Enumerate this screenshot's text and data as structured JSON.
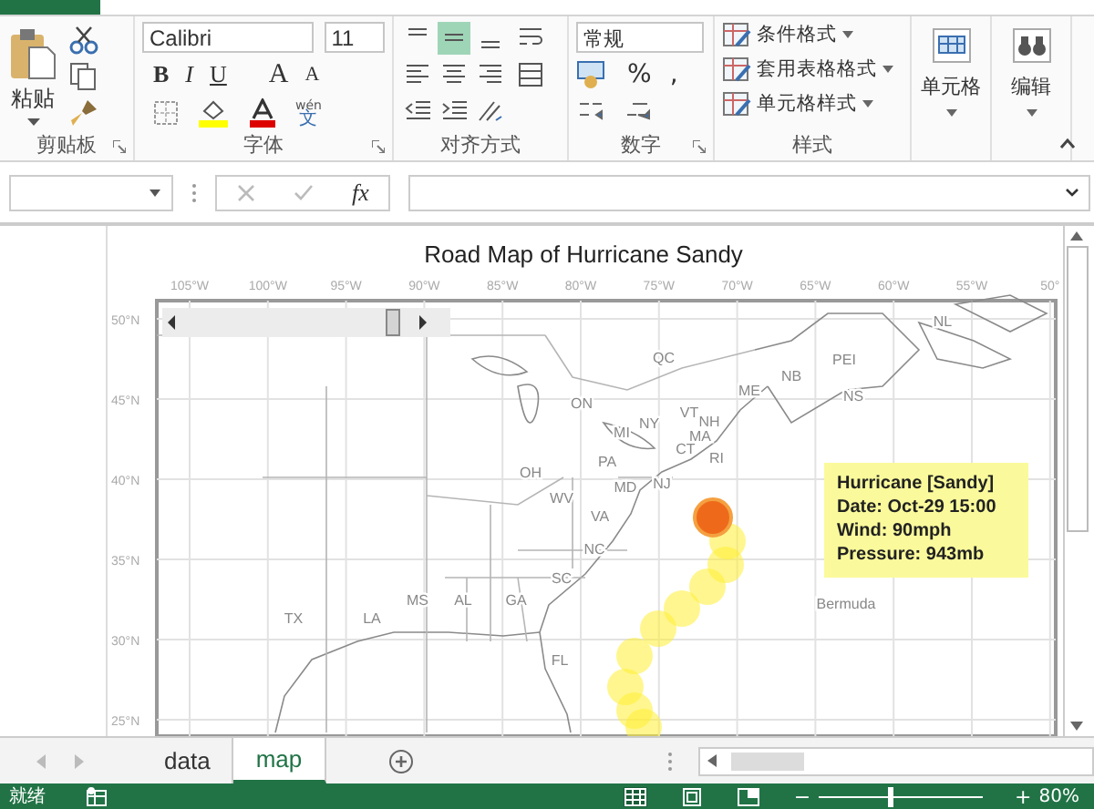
{
  "clipboard": {
    "paste_label": "粘贴",
    "group_label": "剪贴板"
  },
  "font": {
    "name": "Calibri",
    "size": "11",
    "bold": "B",
    "italic": "I",
    "underline": "U",
    "grow": "A",
    "shrink": "A",
    "phonetic_top": "wén",
    "phonetic_bottom": "文",
    "group_label": "字体"
  },
  "alignment": {
    "group_label": "对齐方式",
    "buttons": [
      {
        "kind": "top",
        "selected": false
      },
      {
        "kind": "middle",
        "selected": true
      },
      {
        "kind": "bottom",
        "selected": false
      },
      {
        "kind": "left",
        "selected": false
      },
      {
        "kind": "center",
        "selected": false
      },
      {
        "kind": "right",
        "selected": false
      }
    ]
  },
  "number": {
    "format": "常规",
    "percent": "%",
    "comma": ",",
    "group_label": "数字"
  },
  "styles": {
    "items": [
      "条件格式",
      "套用表格格式",
      "单元格样式"
    ],
    "group_label": "样式"
  },
  "cells": {
    "label": "单元格"
  },
  "editing": {
    "label": "编辑"
  },
  "formula_bar": {
    "fx": "fx"
  },
  "chart": {
    "title": "Road Map of Hurricane Sandy",
    "lon_labels": [
      "105°W",
      "100°W",
      "95°W",
      "90°W",
      "85°W",
      "80°W",
      "75°W",
      "70°W",
      "65°W",
      "60°W",
      "55°W",
      "50°"
    ],
    "lat_labels": [
      "50°N",
      "45°N",
      "40°N",
      "35°N",
      "30°N",
      "25°N"
    ],
    "places": [
      "NL",
      "QC",
      "PEI",
      "NB",
      "ON",
      "ME",
      "NS",
      "VT",
      "NH",
      "NY",
      "MI",
      "MA",
      "CT",
      "RI",
      "PA",
      "OH",
      "NJ",
      "MD",
      "WV",
      "VA",
      "NC",
      "SC",
      "MS",
      "AL",
      "GA",
      "Bermuda",
      "TX",
      "LA",
      "FL"
    ],
    "tooltip": [
      "Hurricane [Sandy]",
      "Date: Oct-29 15:00",
      "Wind: 90mph",
      "Pressure: 943mb"
    ]
  },
  "sheet_tabs": [
    {
      "label": "data",
      "selected": false
    },
    {
      "label": "map",
      "selected": true
    }
  ],
  "status_bar": {
    "text": "就绪",
    "zoom_out": "−",
    "zoom_level": {
      "level": 0.43
    },
    "zoom_in": "+",
    "zoom": "80%"
  }
}
